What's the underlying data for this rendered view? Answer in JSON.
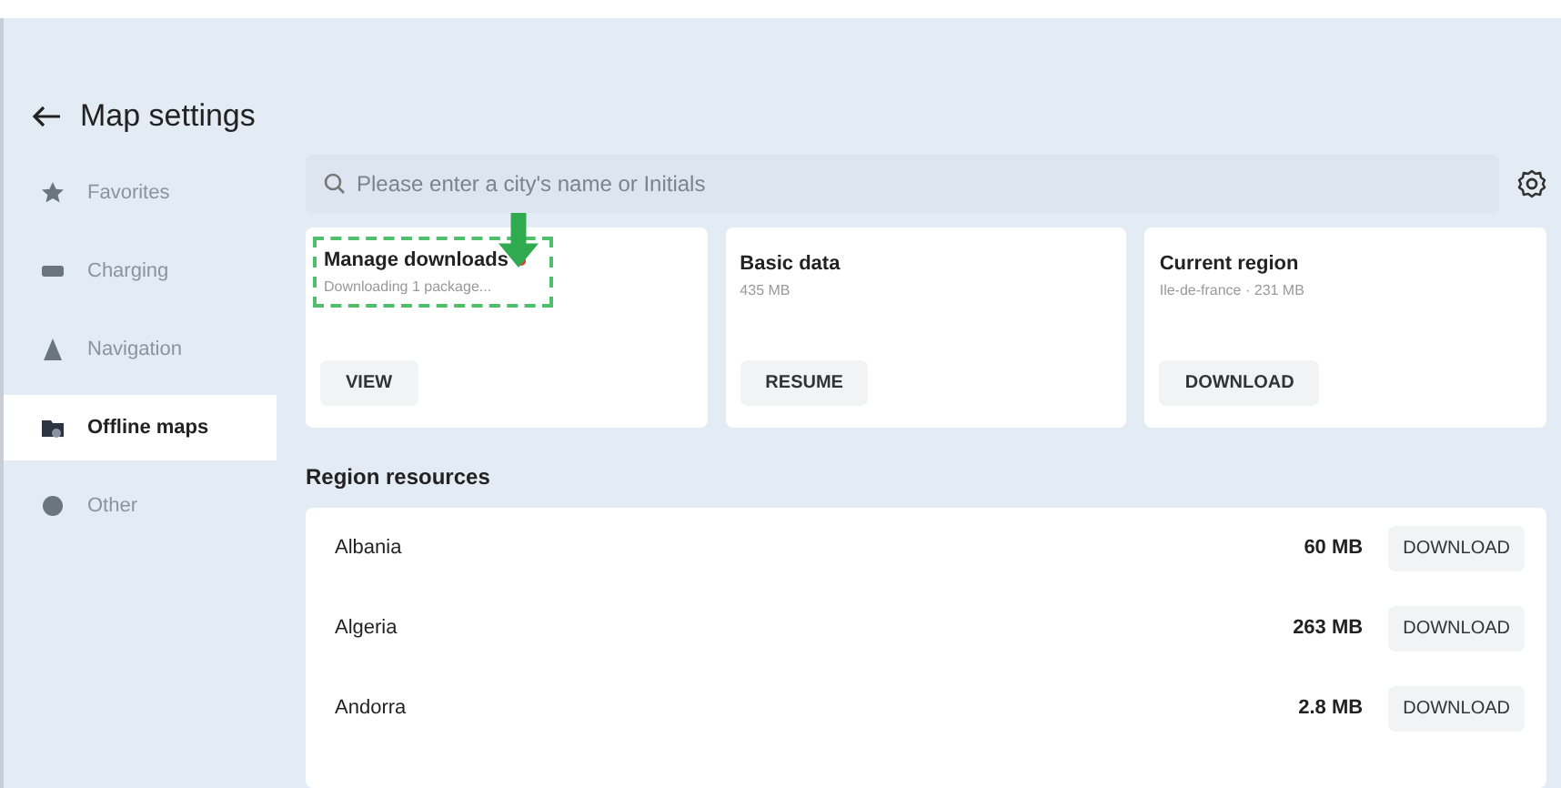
{
  "header": {
    "title": "Map settings"
  },
  "sidebar": {
    "items": [
      {
        "label": "Favorites",
        "kind": "star",
        "selected": false
      },
      {
        "label": "Charging",
        "kind": "battery",
        "selected": false
      },
      {
        "label": "Navigation",
        "kind": "navigation",
        "selected": false
      },
      {
        "label": "Offline maps",
        "kind": "folder",
        "selected": true
      },
      {
        "label": "Other",
        "kind": "circle",
        "selected": false
      }
    ]
  },
  "search": {
    "placeholder": "Please enter a city's name or Initials"
  },
  "cards": [
    {
      "title": "Manage downloads",
      "subtitle": "Downloading 1 package...",
      "badge": true,
      "highlighted": true,
      "button": "VIEW"
    },
    {
      "title": "Basic data",
      "subtitle": "435 MB",
      "badge": false,
      "highlighted": false,
      "button": "RESUME"
    },
    {
      "title": "Current region",
      "subtitle": "Ile-de-france · 231 MB",
      "badge": false,
      "highlighted": false,
      "button": "DOWNLOAD"
    }
  ],
  "region_resources": {
    "heading": "Region resources",
    "rows": [
      {
        "name": "Albania",
        "size": "60 MB",
        "button": "DOWNLOAD"
      },
      {
        "name": "Algeria",
        "size": "263 MB",
        "button": "DOWNLOAD"
      },
      {
        "name": "Andorra",
        "size": "2.8 MB",
        "button": "DOWNLOAD"
      }
    ]
  }
}
